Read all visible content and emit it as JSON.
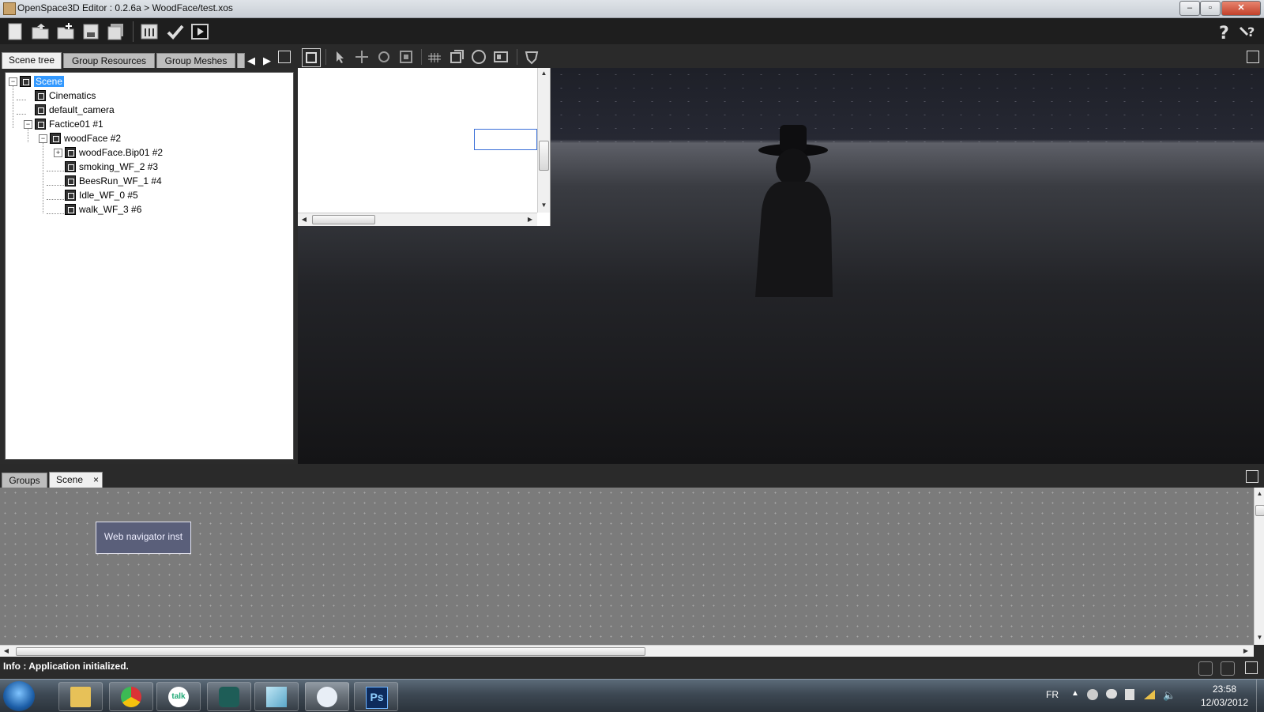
{
  "window": {
    "title": "OpenSpace3D Editor : 0.2.6a > WoodFace/test.xos"
  },
  "left_panel": {
    "tabs": [
      {
        "label": "Scene tree"
      },
      {
        "label": "Group Resources"
      },
      {
        "label": "Group Meshes"
      }
    ],
    "tree": [
      {
        "label": "Scene"
      },
      {
        "label": "Cinematics"
      },
      {
        "label": "default_camera"
      },
      {
        "label": "Factice01 #1"
      },
      {
        "label": "woodFace #2"
      },
      {
        "label": "woodFace.Bip01 #2"
      },
      {
        "label": "smoking_WF_2 #3"
      },
      {
        "label": "BeesRun_WF_1 #4"
      },
      {
        "label": "Idle_WF_0 #5"
      },
      {
        "label": "walk_WF_3 #6"
      }
    ]
  },
  "bottom_panel": {
    "tabs": [
      {
        "label": "Groups"
      },
      {
        "label": "Scene"
      }
    ],
    "close_glyph": "×",
    "nodes": [
      {
        "label": "Web navigator inst"
      }
    ]
  },
  "status": {
    "text": "Info : Application initialized."
  },
  "taskbar": {
    "apps": [
      {
        "icon": "explorer-icon"
      },
      {
        "icon": "chrome-icon"
      },
      {
        "icon": "talk-icon"
      },
      {
        "icon": "app-s-icon"
      },
      {
        "icon": "notepad-icon"
      },
      {
        "icon": "openspace-icon"
      },
      {
        "icon": "photoshop-icon",
        "label": "Ps"
      }
    ],
    "talk_label": "talk",
    "language": "FR",
    "time": "23:58",
    "date": "12/03/2012"
  }
}
